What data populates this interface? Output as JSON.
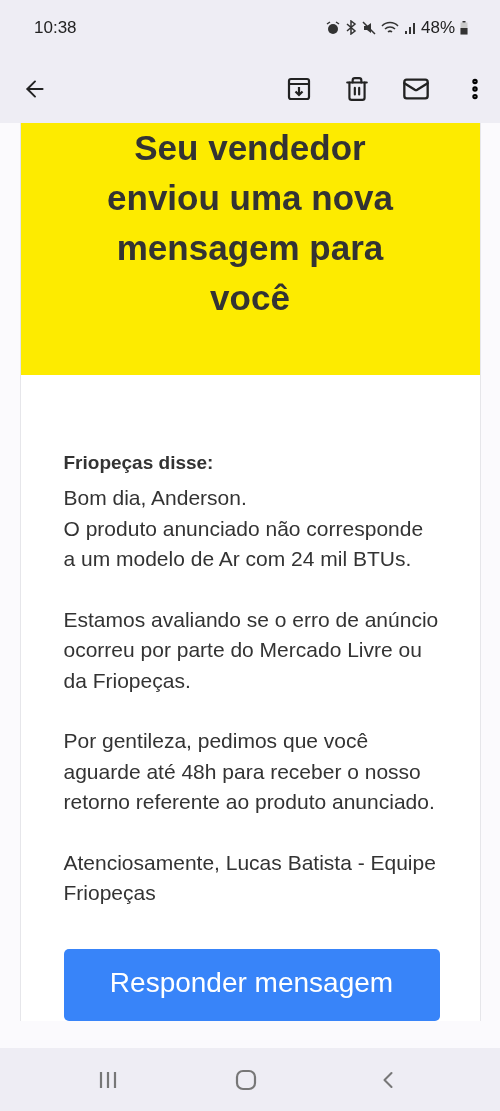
{
  "status_bar": {
    "time": "10:38",
    "battery": "48%"
  },
  "email": {
    "headline": "Seu vendedor enviou uma nova mensagem para você",
    "sender": "Friopeças disse:",
    "paragraphs": [
      "Bom dia, Anderson.\nO produto anunciado não corresponde a um modelo de Ar com 24 mil BTUs.",
      "Estamos avaliando se o erro de anúncio ocorreu por parte do Mercado Livre ou da Friopeças.",
      "Por gentileza, pedimos que você aguarde até 48h para receber o nosso retorno referente ao produto anunciado.",
      "Atenciosamente, Lucas Batista - Equipe Friopeças"
    ],
    "button": "Responder mensagem"
  }
}
